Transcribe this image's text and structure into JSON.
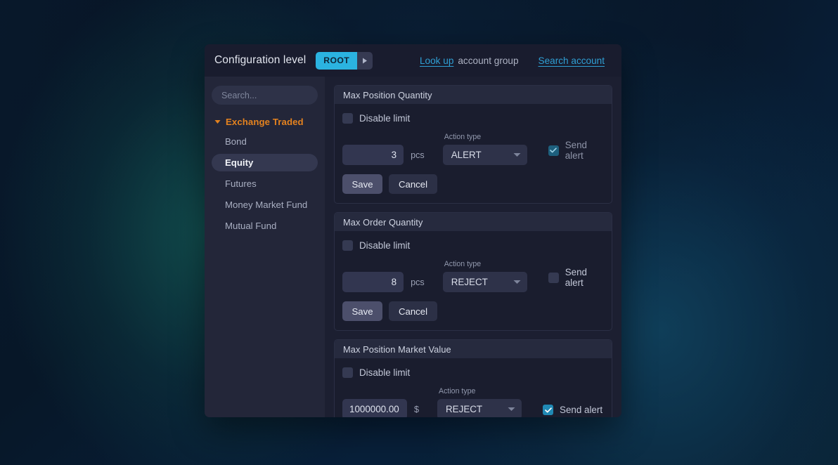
{
  "topbar": {
    "title": "Configuration level",
    "root_chip": {
      "label": "ROOT",
      "arrow_icon": "caret-right-icon"
    },
    "lookup_link": "Look up",
    "lookup_suffix": "account group",
    "search_account_link": "Search account"
  },
  "sidebar": {
    "search_placeholder": "Search...",
    "group": {
      "label": "Exchange Traded",
      "expanded": true,
      "caret_icon": "caret-down-icon"
    },
    "items": [
      {
        "label": "Bond",
        "selected": false
      },
      {
        "label": "Equity",
        "selected": true
      },
      {
        "label": "Futures",
        "selected": false
      },
      {
        "label": "Money Market Fund",
        "selected": false
      },
      {
        "label": "Mutual Fund",
        "selected": false
      }
    ]
  },
  "labels": {
    "disable_limit": "Disable limit",
    "action_type": "Action type",
    "send_alert": "Send alert",
    "save": "Save",
    "cancel": "Cancel",
    "dropdown_icon": "caret-down-icon",
    "check_icon": "check-icon"
  },
  "cards": [
    {
      "title": "Max Position Quantity",
      "disable_limit_checked": false,
      "value": "3",
      "value_align": "right",
      "unit": "pcs",
      "action_type": "ALERT",
      "send_alert_checked": true,
      "send_alert_disabled": true
    },
    {
      "title": "Max Order Quantity",
      "disable_limit_checked": false,
      "value": "8",
      "value_align": "right",
      "unit": "pcs",
      "action_type": "REJECT",
      "send_alert_checked": false,
      "send_alert_disabled": false
    },
    {
      "title": "Max Position Market Value",
      "disable_limit_checked": false,
      "value": "1000000.00",
      "value_align": "left",
      "unit": "$",
      "action_type": "REJECT",
      "send_alert_checked": true,
      "send_alert_disabled": false
    }
  ],
  "colors": {
    "accent_cyan": "#2bb3e0",
    "link_blue": "#2f9fd4",
    "group_orange": "#e4821f",
    "checkbox_on": "#2089b4"
  }
}
